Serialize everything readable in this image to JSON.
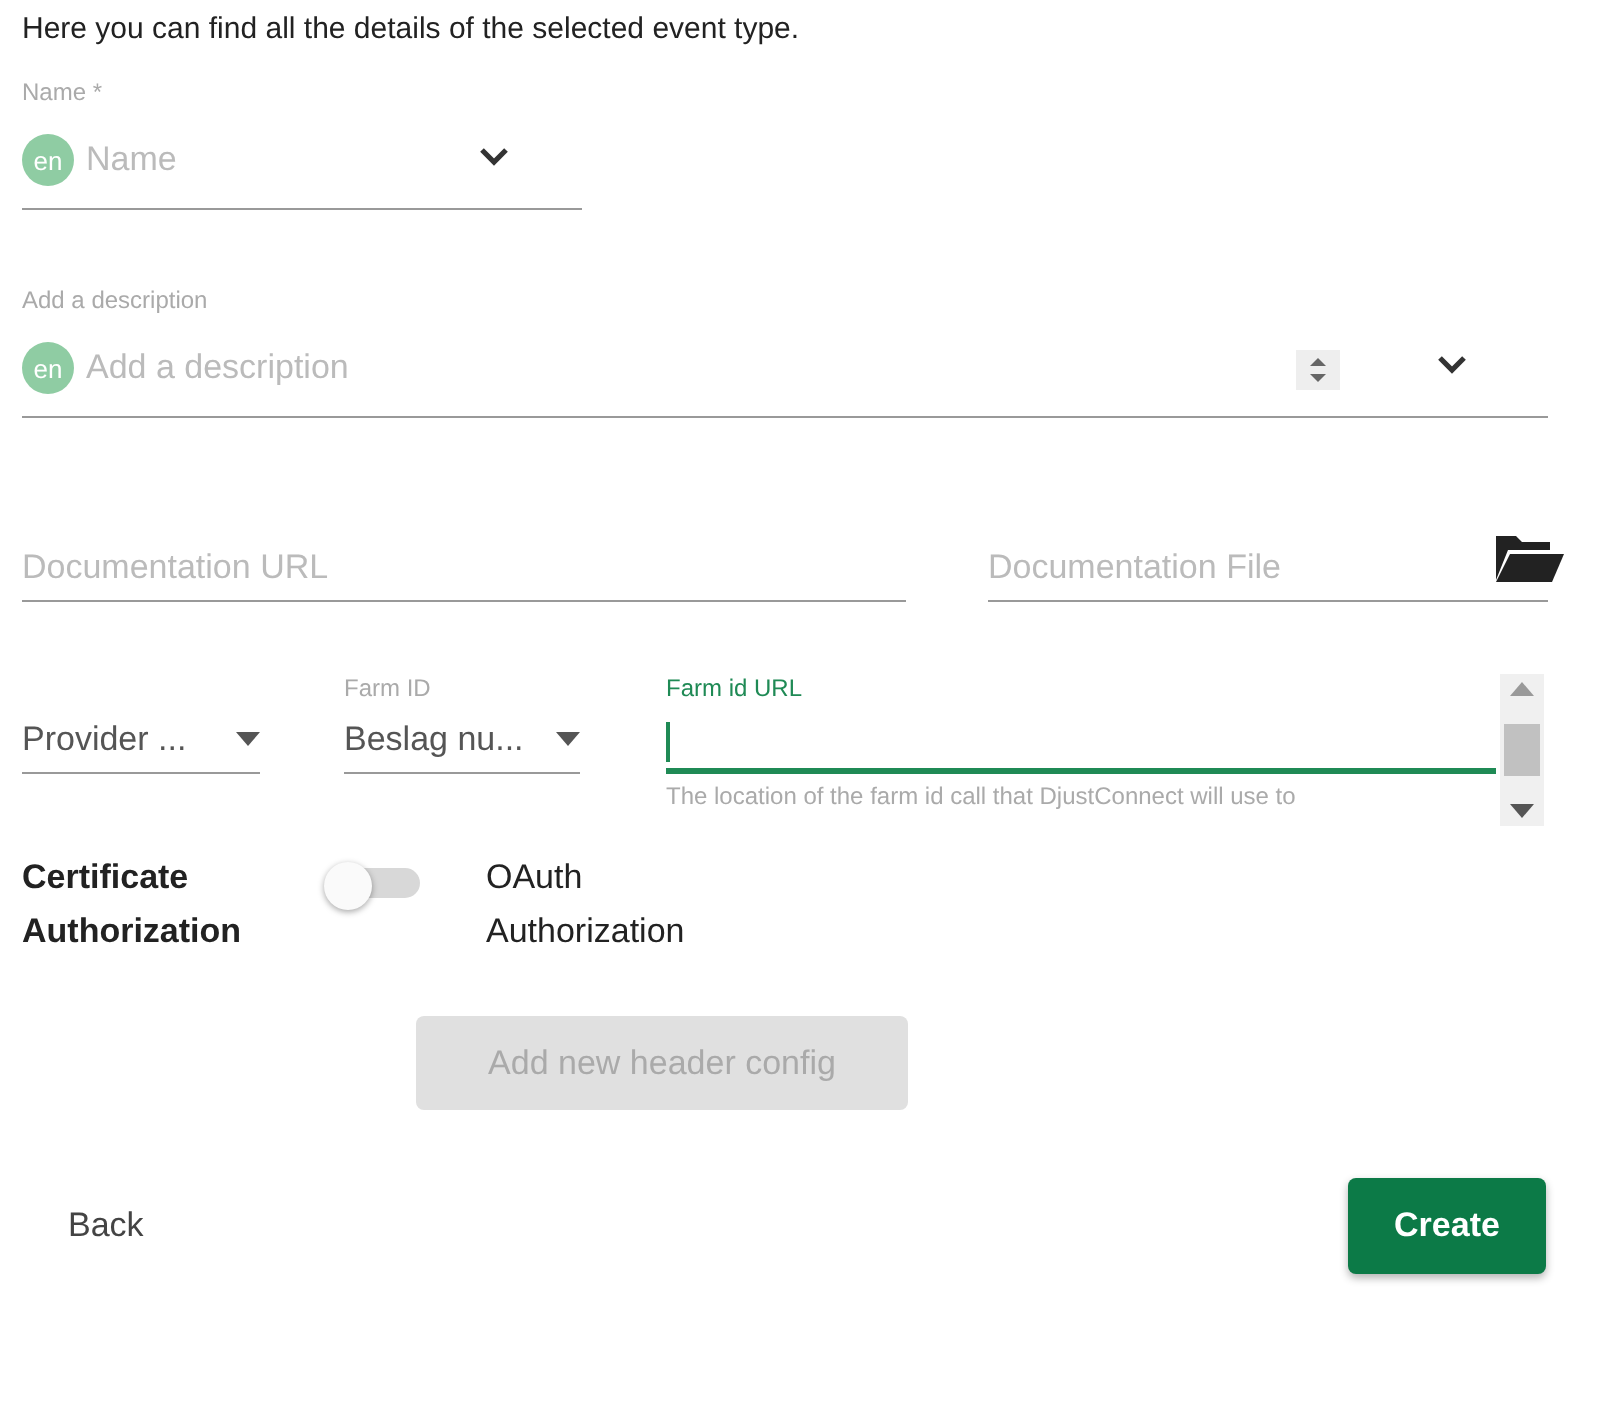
{
  "intro": "Here you can find all the details of the selected event type.",
  "name_field": {
    "label": "Name *",
    "language": "en",
    "placeholder": "Name"
  },
  "description_field": {
    "label": "Add a description",
    "language": "en",
    "placeholder": "Add a description"
  },
  "documentation_url": {
    "placeholder": "Documentation URL"
  },
  "documentation_file": {
    "placeholder": "Documentation File"
  },
  "provider_select": {
    "value": "Provider ..."
  },
  "farm_id_select": {
    "label": "Farm ID",
    "value": "Beslag nu..."
  },
  "farm_id_url": {
    "label": "Farm id URL",
    "focused": true,
    "helper": "The location of the farm id call that DjustConnect will use to"
  },
  "authorization": {
    "left_label": "Certificate Authorization",
    "right_label": "OAuth Authorization",
    "on": false
  },
  "add_header_button": {
    "label": "Add new header config",
    "disabled": true
  },
  "back_button": "Back",
  "create_button": "Create"
}
